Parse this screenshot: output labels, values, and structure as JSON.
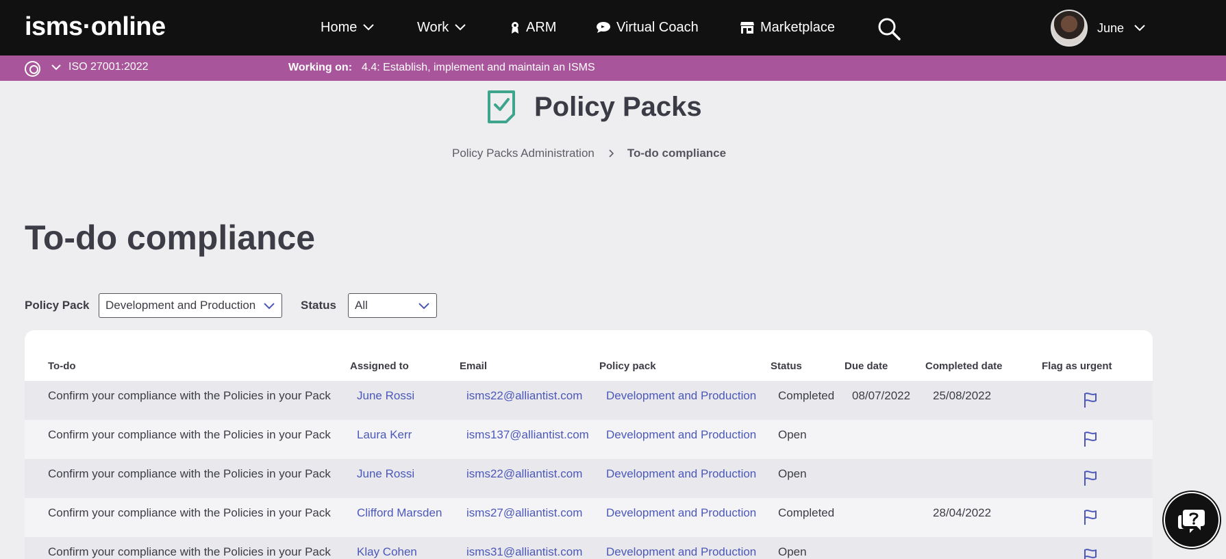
{
  "nav": {
    "logo": "isms·online",
    "items": [
      {
        "label": "Home"
      },
      {
        "label": "Work"
      },
      {
        "label": "ARM"
      },
      {
        "label": "Virtual Coach"
      },
      {
        "label": "Marketplace"
      }
    ],
    "user": "June"
  },
  "workbar": {
    "standard": "ISO 27001:2022",
    "working_label": "Working on:",
    "working_value": "4.4: Establish, implement and maintain an ISMS"
  },
  "header": {
    "title": "Policy Packs",
    "breadcrumb": {
      "parent": "Policy Packs Administration",
      "current": "To-do compliance"
    }
  },
  "page_title": "To-do compliance",
  "filters": {
    "policy_pack_label": "Policy Pack",
    "policy_pack_value": "Development and Production",
    "status_label": "Status",
    "status_value": "All"
  },
  "table": {
    "headers": [
      "To-do",
      "Assigned to",
      "Email",
      "Policy pack",
      "Status",
      "Due date",
      "Completed date",
      "Flag as urgent"
    ],
    "rows": [
      {
        "todo": "Confirm your compliance with the Policies in your Pack",
        "assigned": "June Rossi",
        "email": "isms22@alliantist.com",
        "pack": "Development and Production",
        "status": "Completed",
        "due": "08/07/2022",
        "completed": "25/08/2022"
      },
      {
        "todo": "Confirm your compliance with the Policies in your Pack",
        "assigned": "Laura Kerr",
        "email": "isms137@alliantist.com",
        "pack": "Development and Production",
        "status": "Open",
        "due": "",
        "completed": ""
      },
      {
        "todo": "Confirm your compliance with the Policies in your Pack",
        "assigned": "June Rossi",
        "email": "isms22@alliantist.com",
        "pack": "Development and Production",
        "status": "Open",
        "due": "",
        "completed": ""
      },
      {
        "todo": "Confirm your compliance with the Policies in your Pack",
        "assigned": "Clifford Marsden",
        "email": "isms27@alliantist.com",
        "pack": "Development and Production",
        "status": "Completed",
        "due": "",
        "completed": "28/04/2022"
      },
      {
        "todo": "Confirm your compliance with the Policies in your Pack",
        "assigned": "Klay Cohen",
        "email": "isms31@alliantist.com",
        "pack": "Development and Production",
        "status": "Open",
        "due": "",
        "completed": ""
      }
    ]
  },
  "colors": {
    "topnav": "#111111",
    "workbar": "#a9559b",
    "link": "#4b58b8",
    "brand_icon": "#3fa48c"
  }
}
